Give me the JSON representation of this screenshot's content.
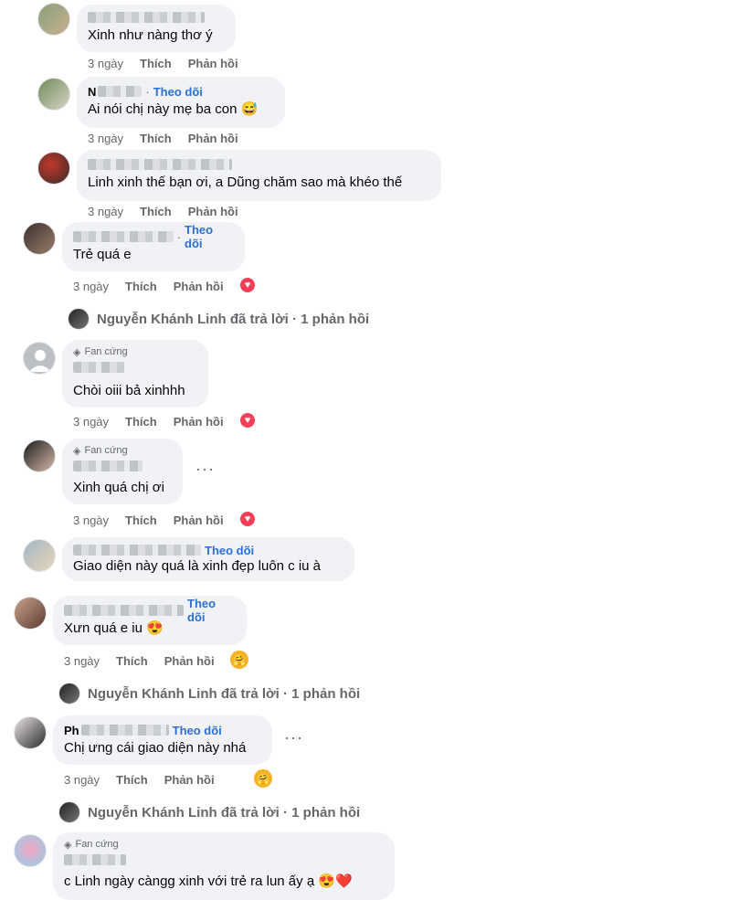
{
  "meta": {
    "time": "3 ngày",
    "like": "Thích",
    "reply": "Phản hồi"
  },
  "follow_label": "Theo dõi",
  "fan_badge": "Fan cứng",
  "reply_summary": "Nguyễn Khánh Linh đã trả lời · 1 phản hồi",
  "comments": [
    {
      "text": "Xinh như nàng thơ ý"
    },
    {
      "name_prefix": "N",
      "text": "Ai nói chị này mẹ ba con",
      "emoji": "😅"
    },
    {
      "text": "Linh xinh thế bạn ơi, a Dũng chăm sao mà khéo thế"
    },
    {
      "text": "Trẻ quá e"
    },
    {
      "text": "Chòi oiii bả xinhhh"
    },
    {
      "text": "Xinh quá chị ơi"
    },
    {
      "text": "Giao diện này quá là xinh đẹp luôn c iu à"
    },
    {
      "text": "Xưn quá e iu",
      "emoji": "😍"
    },
    {
      "name_prefix": "Ph",
      "text": "Chị ưng cái giao diện này nhá"
    },
    {
      "text": "c Linh ngày càngg xinh với trẻ ra lun ấy ạ",
      "emoji": "😍❤️"
    }
  ],
  "icons": {
    "heart": "heart-icon",
    "care": "care-icon",
    "more": "more-icon",
    "fan": "diamond-icon"
  },
  "colors": {
    "bubble": "#f0f2f5",
    "link": "#2d6fd2",
    "meta": "#65676b",
    "heart": "#f33e58"
  }
}
